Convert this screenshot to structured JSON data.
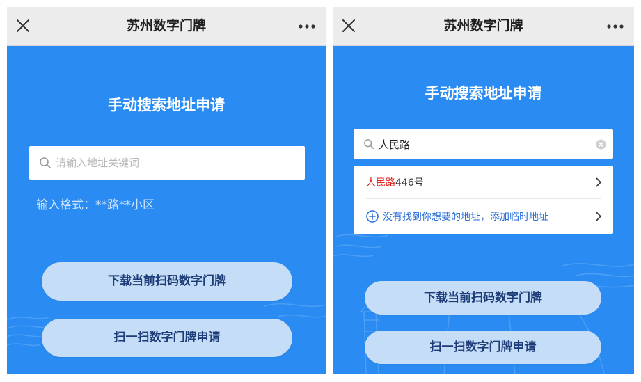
{
  "left": {
    "title": "苏州数字门牌",
    "heading": "手动搜索地址申请",
    "search": {
      "placeholder": "请输入地址关键词",
      "value": ""
    },
    "format_hint": "输入格式：**路**小区",
    "buttons": {
      "download": "下载当前扫码数字门牌",
      "scan": "扫一扫数字门牌申请"
    }
  },
  "right": {
    "title": "苏州数字门牌",
    "heading": "手动搜索地址申请",
    "search": {
      "value": "人民路"
    },
    "results": [
      {
        "highlight": "人民路",
        "rest": "446号"
      }
    ],
    "add_temp": "没有找到你想要的地址，添加临时地址",
    "buttons": {
      "download": "下载当前扫码数字门牌",
      "scan": "扫一扫数字门牌申请"
    }
  },
  "colors": {
    "screen_bg": "#2a8cf2",
    "topbar_bg": "#ececec",
    "pill_bg": "#c6ddf7",
    "pill_text": "#1d3c78",
    "highlight": "#e0211d",
    "link": "#2a6fd6"
  },
  "icons": [
    "close-icon",
    "more-icon",
    "search-icon",
    "clear-icon",
    "chevron-right-icon",
    "plus-circle-icon"
  ]
}
